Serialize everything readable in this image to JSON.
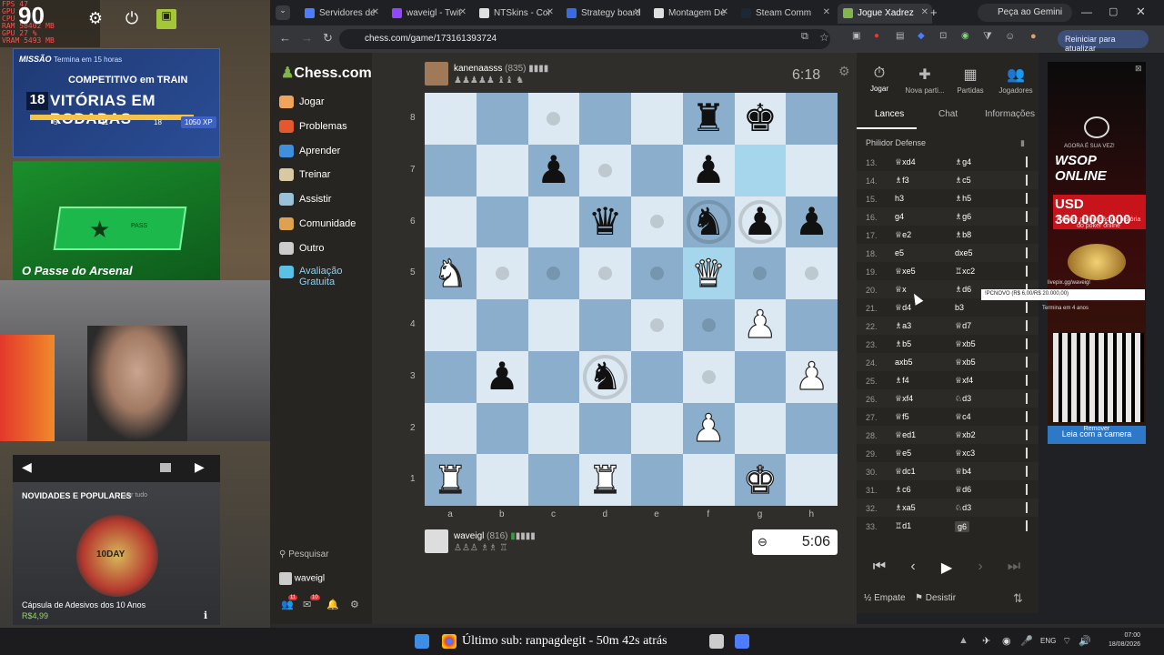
{
  "overlay": {
    "perf_lines": [
      "FPS 47",
      "GPU",
      "CPU",
      "RAM 58402 MB",
      "GPU 27 %",
      "VRAM 5493 MB"
    ],
    "fps": "90",
    "mission": {
      "label": "MISSÃO",
      "time": "Termina em 15 horas",
      "title1": "COMPETITIVO em TRAIN",
      "count": "18",
      "title2": "VITÓRIAS EM RODADAS",
      "marks": [
        "5",
        "11",
        "18"
      ],
      "xp": "1050 XP",
      "progress": 1.0
    },
    "pass_title": "O Passe do Arsenal",
    "pass_card_label": "PASS",
    "novidades": {
      "header": "NOVIDADES E POPULARES",
      "see_all": "Ver tudo",
      "item": "Cápsula de Adesivos dos 10 Anos",
      "price": "R$4,99",
      "badge": "10DAY"
    }
  },
  "browser": {
    "tabs": [
      {
        "label": "Servidores de",
        "color": "#4d7cfe"
      },
      {
        "label": "waveigl - Twit",
        "color": "#9146ff"
      },
      {
        "label": "NTSkins - Cor",
        "color": "#e0e0e0"
      },
      {
        "label": "Strategy board",
        "color": "#3b6be0"
      },
      {
        "label": "Montagem De",
        "color": "#e0e0e0"
      },
      {
        "label": "Steam Comm",
        "color": "#1b2838"
      },
      {
        "label": "Jogue Xadrez",
        "color": "#81b64c"
      }
    ],
    "gemini": "Peça ao Gemini",
    "url": "chess.com/game/173161393724",
    "restart": "Reiniciar para atualizar"
  },
  "sidebar": {
    "logo": "Chess.com",
    "items": [
      {
        "label": "Jogar",
        "color": "#f0a35b"
      },
      {
        "label": "Problemas",
        "color": "#e3582c"
      },
      {
        "label": "Aprender",
        "color": "#3f8fdc"
      },
      {
        "label": "Treinar",
        "color": "#d9c9a3"
      },
      {
        "label": "Assistir",
        "color": "#9ac3d9"
      },
      {
        "label": "Comunidade",
        "color": "#dca24f"
      },
      {
        "label": "Outro",
        "color": "#cccccc"
      },
      {
        "label": "Avaliação Gratuita",
        "color": "#59c0e6"
      }
    ],
    "search": "Pesquisar",
    "user": "waveigl",
    "badges": [
      "11",
      "10"
    ]
  },
  "game": {
    "top_player": {
      "name": "kanenaasss",
      "rating": "(835)",
      "captured": "♟♟♟♟♟ ♝♝ ♞",
      "clock": "6:18"
    },
    "bottom_player": {
      "name": "waveigl",
      "rating": "(816)",
      "captured": "♙♙♙ ♗♗ ♖",
      "clock": "5:06"
    },
    "files": [
      "a",
      "b",
      "c",
      "d",
      "e",
      "f",
      "g",
      "h"
    ],
    "ranks": [
      "8",
      "7",
      "6",
      "5",
      "4",
      "3",
      "2",
      "1"
    ],
    "board": [
      [
        "",
        "",
        ".",
        "",
        "",
        "br",
        "bk",
        ""
      ],
      [
        "",
        "",
        "bp",
        ".",
        "",
        "bp",
        "*",
        ""
      ],
      [
        "",
        "",
        "",
        "bq",
        ".",
        "bn",
        "bp",
        "bp"
      ],
      [
        "wn",
        ".",
        ".",
        ".",
        ".",
        "wq",
        ".",
        "."
      ],
      [
        "",
        "",
        "",
        "",
        ".",
        ".",
        "wp",
        ""
      ],
      [
        "",
        "bp",
        "",
        "bn",
        "",
        ".",
        "",
        "wp"
      ],
      [
        "",
        "",
        "",
        "",
        "",
        "wp",
        "",
        ""
      ],
      [
        "wr",
        "",
        "",
        "wr",
        "",
        "",
        "wk",
        ""
      ]
    ],
    "highlight": [
      [
        1,
        6
      ],
      [
        3,
        5
      ]
    ],
    "rings": [
      [
        2,
        5
      ],
      [
        2,
        6
      ],
      [
        5,
        3
      ]
    ]
  },
  "panel": {
    "tabs": [
      {
        "label": "Jogar",
        "icon": "⏱"
      },
      {
        "label": "Nova parti...",
        "icon": "✚"
      },
      {
        "label": "Partidas",
        "icon": "▦"
      },
      {
        "label": "Jogadores",
        "icon": "👥"
      }
    ],
    "subtabs": [
      "Lances",
      "Chat",
      "Informações"
    ],
    "opening": "Philidor Defense",
    "moves": [
      [
        "13.",
        "♕xd4",
        "♗g4"
      ],
      [
        "14.",
        "♗f3",
        "♗c5"
      ],
      [
        "15.",
        "h3",
        "♗h5"
      ],
      [
        "16.",
        "g4",
        "♗g6"
      ],
      [
        "17.",
        "♕e2",
        "♗b8"
      ],
      [
        "18.",
        "e5",
        "dxe5"
      ],
      [
        "19.",
        "♕xe5",
        "♖xc2"
      ],
      [
        "20.",
        "♕x",
        "♗d6"
      ],
      [
        "21.",
        "♕d4",
        "b3"
      ],
      [
        "22.",
        "♗a3",
        "♕d7"
      ],
      [
        "23.",
        "♗b5",
        "♕xb5"
      ],
      [
        "24.",
        "axb5",
        "♕xb5"
      ],
      [
        "25.",
        "♗f4",
        "♕xf4"
      ],
      [
        "26.",
        "♕xf4",
        "♘d3"
      ],
      [
        "27.",
        "♕f5",
        "♕c4"
      ],
      [
        "28.",
        "♕ed1",
        "♕xb2"
      ],
      [
        "29.",
        "♕e5",
        "♕xc3"
      ],
      [
        "30.",
        "♕dc1",
        "♕b4"
      ],
      [
        "31.",
        "♗c6",
        "♕d6"
      ],
      [
        "32.",
        "♗xa5",
        "♘d3"
      ],
      [
        "33.",
        "♖d1",
        "g6"
      ]
    ],
    "draw": "Empate",
    "resign": "Desistir"
  },
  "ad": {
    "sub": "AGORA É SUA VEZ!",
    "title": "WSOP ONLINE",
    "amount": "USD 360.000.000",
    "desc": "A maior premiação da história do poker online",
    "url": "livepix.gg/waveigl",
    "tooltip": "!PCNOVO (R$ 6,00/R$ 20.000,00)",
    "term": "Termina em 4 anos",
    "camera": "Leia com a camera",
    "remove": "Remover"
  },
  "taskbar": {
    "text": "Último sub: ranpagdegit - 50m 42s atrás",
    "lang": "ENG",
    "time": "07:00",
    "date": "18/08/2026"
  }
}
